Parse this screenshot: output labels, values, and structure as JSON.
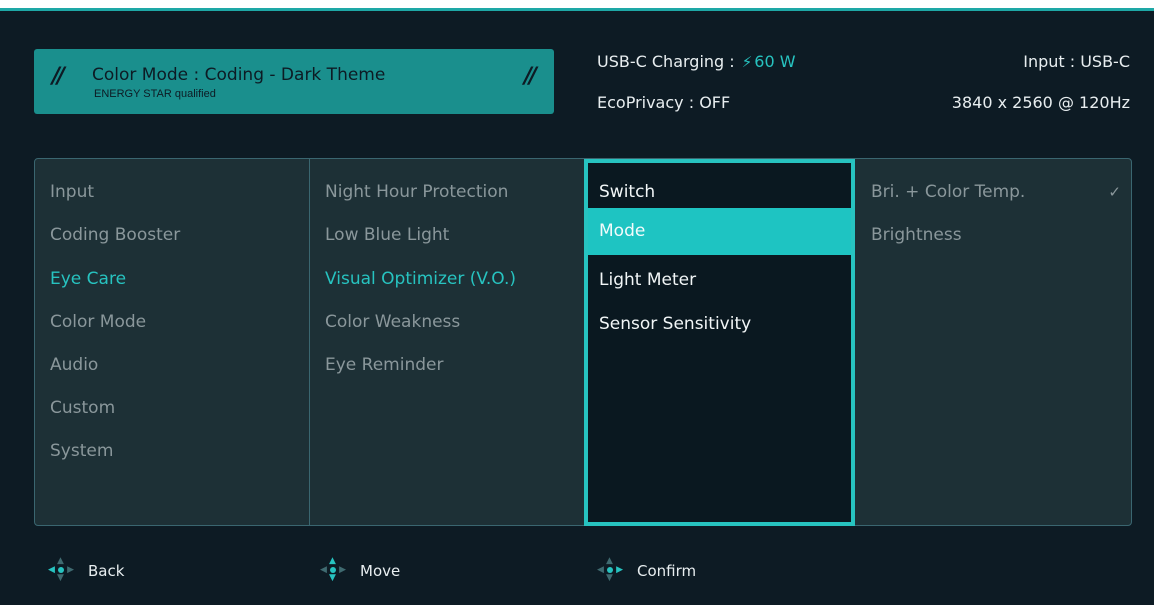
{
  "header": {
    "color_mode": "Color Mode : Coding - Dark Theme",
    "energy_star": "ENERGY STAR qualified",
    "usb_c_label": "USB-C Charging : ",
    "usb_c_value": "60 W",
    "input": "Input : USB-C",
    "ecoprivacy": "EcoPrivacy : OFF",
    "resolution": "3840 x 2560 @ 120Hz"
  },
  "menu": {
    "col1": [
      "Input",
      "Coding Booster",
      "Eye Care",
      "Color Mode",
      "Audio",
      "Custom",
      "System"
    ],
    "col2": [
      "Night Hour Protection",
      "Low Blue Light",
      "Visual Optimizer (V.O.)",
      "Color Weakness",
      "Eye Reminder"
    ],
    "col3": [
      "Switch",
      "Mode",
      "Light Meter",
      "Sensor Sensitivity"
    ],
    "col4": [
      "Bri. + Color Temp.",
      "Brightness"
    ]
  },
  "footer": {
    "back": "Back",
    "move": "Move",
    "confirm": "Confirm"
  },
  "colors": {
    "accent": "#27c3c0",
    "background": "#0d1b24",
    "badge": "#1a8f8d"
  }
}
